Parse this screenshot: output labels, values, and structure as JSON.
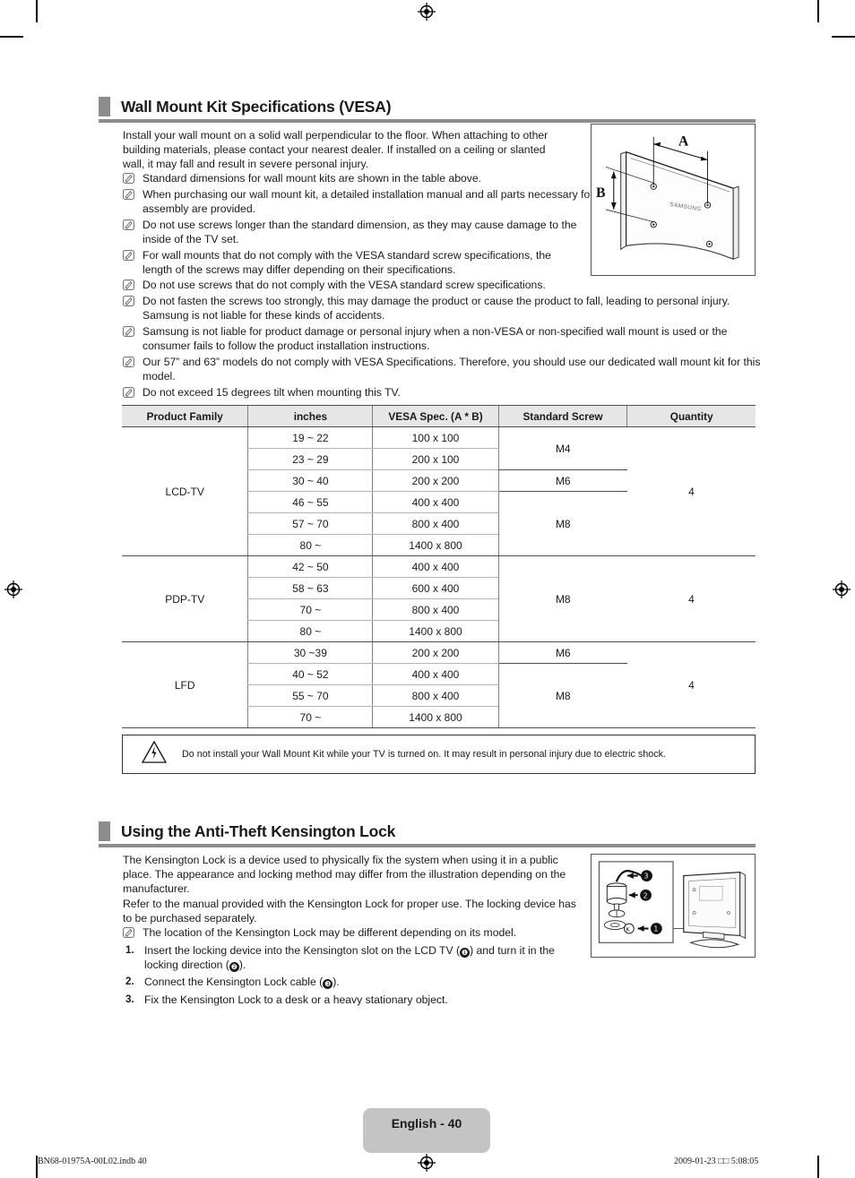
{
  "page": {
    "footer_tag": "English - 40",
    "footer_left": "BN68-01975A-00L02.indb   40",
    "footer_right": "2009-01-23   □□ 5:08:05"
  },
  "section1": {
    "title": "Wall Mount Kit Specifications (VESA)",
    "intro": "Install your wall mount on a solid wall perpendicular to the floor. When attaching to other building materials, please contact your nearest dealer. If installed on a ceiling or slanted wall, it may fall and result in severe personal injury.",
    "notes": [
      "Standard dimensions for wall mount kits are shown in the table above.",
      "When purchasing our wall mount kit, a detailed installation manual and all parts necessary for assembly are provided.",
      "Do not use screws longer than the standard dimension, as they may cause damage to the inside of the TV set.",
      "For wall mounts that do not comply with the VESA standard screw specifications, the length of the screws may differ depending on their specifications.",
      "Do not use screws that do not comply with the VESA standard screw specifications.",
      "Do not fasten the screws too strongly, this may damage the product or cause the product to fall, leading to personal injury. Samsung is not liable for these kinds of accidents.",
      "Samsung is not liable for product damage or personal injury when a non-VESA or non-specified wall mount is used or the consumer fails to follow the product installation instructions.",
      "Our 57” and 63” models do not comply with VESA Specifications. Therefore, you should use our dedicated wall mount kit for this model.",
      "Do not exceed 15 degrees tilt when mounting this TV."
    ],
    "illustration": {
      "label_a": "A",
      "label_b": "B",
      "brand": "SAMSUNG"
    },
    "caution": "Do not install your Wall Mount Kit while your TV is turned on. It may result in personal injury due to electric shock."
  },
  "table": {
    "headers": [
      "Product Family",
      "inches",
      "VESA Spec. (A * B)",
      "Standard Screw",
      "Quantity"
    ],
    "groups": [
      {
        "family": "LCD-TV",
        "quantity": "4",
        "rows": [
          {
            "inches": "19 ~ 22",
            "vesa": "100 x 100",
            "screw": "M4",
            "screw_span": 2
          },
          {
            "inches": "23 ~ 29",
            "vesa": "200 x 100"
          },
          {
            "inches": "30 ~ 40",
            "vesa": "200 x 200",
            "screw": "M6",
            "screw_span": 1
          },
          {
            "inches": "46 ~ 55",
            "vesa": "400 x 400",
            "screw": "M8",
            "screw_span": 3
          },
          {
            "inches": "57 ~ 70",
            "vesa": "800 x 400"
          },
          {
            "inches": "80 ~",
            "vesa": "1400 x 800"
          }
        ]
      },
      {
        "family": "PDP-TV",
        "quantity": "4",
        "rows": [
          {
            "inches": "42 ~ 50",
            "vesa": "400 x 400",
            "screw": "M8",
            "screw_span": 4
          },
          {
            "inches": "58 ~ 63",
            "vesa": "600 x 400"
          },
          {
            "inches": "70 ~",
            "vesa": "800 x 400"
          },
          {
            "inches": "80 ~",
            "vesa": "1400 x 800"
          }
        ]
      },
      {
        "family": "LFD",
        "quantity": "4",
        "rows": [
          {
            "inches": "30 ~39",
            "vesa": "200 x 200",
            "screw": "M6",
            "screw_span": 1
          },
          {
            "inches": "40 ~ 52",
            "vesa": "400 x 400",
            "screw": "M8",
            "screw_span": 3
          },
          {
            "inches": "55 ~ 70",
            "vesa": "800 x 400"
          },
          {
            "inches": "70 ~",
            "vesa": "1400 x 800"
          }
        ]
      }
    ]
  },
  "section2": {
    "title": "Using the Anti-Theft Kensington Lock",
    "para1": "The Kensington Lock is a device used to physically fix the system when using it in a public place. The appearance and locking method may differ from the illustration depending on the manufacturer.",
    "para2": "Refer to the manual provided with the Kensington Lock for proper use. The locking device has to be purchased separately.",
    "notes": [
      "The location of the Kensington Lock may be different depending on its model."
    ],
    "steps": [
      {
        "num": "1.",
        "pre": "Insert the locking device into the Kensington slot on the LCD TV (",
        "c1": "❶",
        "mid": ") and turn it in the locking direction (",
        "c2": "❷",
        "post": ")."
      },
      {
        "num": "2.",
        "pre": "Connect the Kensington Lock cable (",
        "c1": "❸",
        "mid": "",
        "c2": "",
        "post": ")."
      },
      {
        "num": "3.",
        "pre": "Fix the Kensington Lock to a desk or a heavy stationary object.",
        "c1": "",
        "mid": "",
        "c2": "",
        "post": ""
      }
    ],
    "illustration": {
      "callout1": "1",
      "callout2": "2",
      "callout3": "3"
    }
  }
}
